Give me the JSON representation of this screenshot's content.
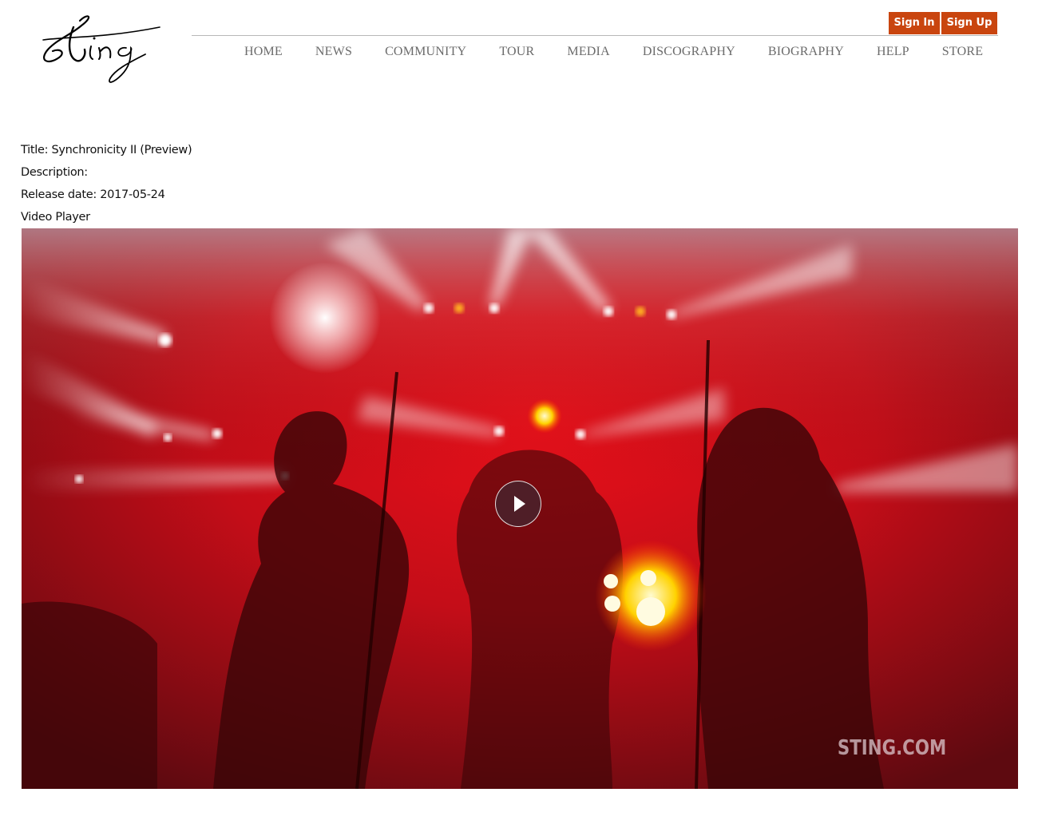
{
  "header": {
    "logo_text": "Sting",
    "auth": {
      "sign_in": "Sign In",
      "sign_up": "Sign Up"
    },
    "nav": [
      {
        "label": "HOME"
      },
      {
        "label": "NEWS"
      },
      {
        "label": "COMMUNITY"
      },
      {
        "label": "TOUR"
      },
      {
        "label": "MEDIA"
      },
      {
        "label": "DISCOGRAPHY"
      },
      {
        "label": "BIOGRAPHY"
      },
      {
        "label": "HELP"
      },
      {
        "label": "STORE"
      }
    ]
  },
  "colors": {
    "accent": "#c9450f",
    "nav_text": "#6b6b6b"
  },
  "media": {
    "title_line": "Title: Synchronicity II (Preview)",
    "description_line": "Description:",
    "release_line": "Release date: 2017-05-24",
    "player_label": "Video Player"
  },
  "video": {
    "watermark": "STING.COM",
    "play_icon": "play-icon"
  }
}
